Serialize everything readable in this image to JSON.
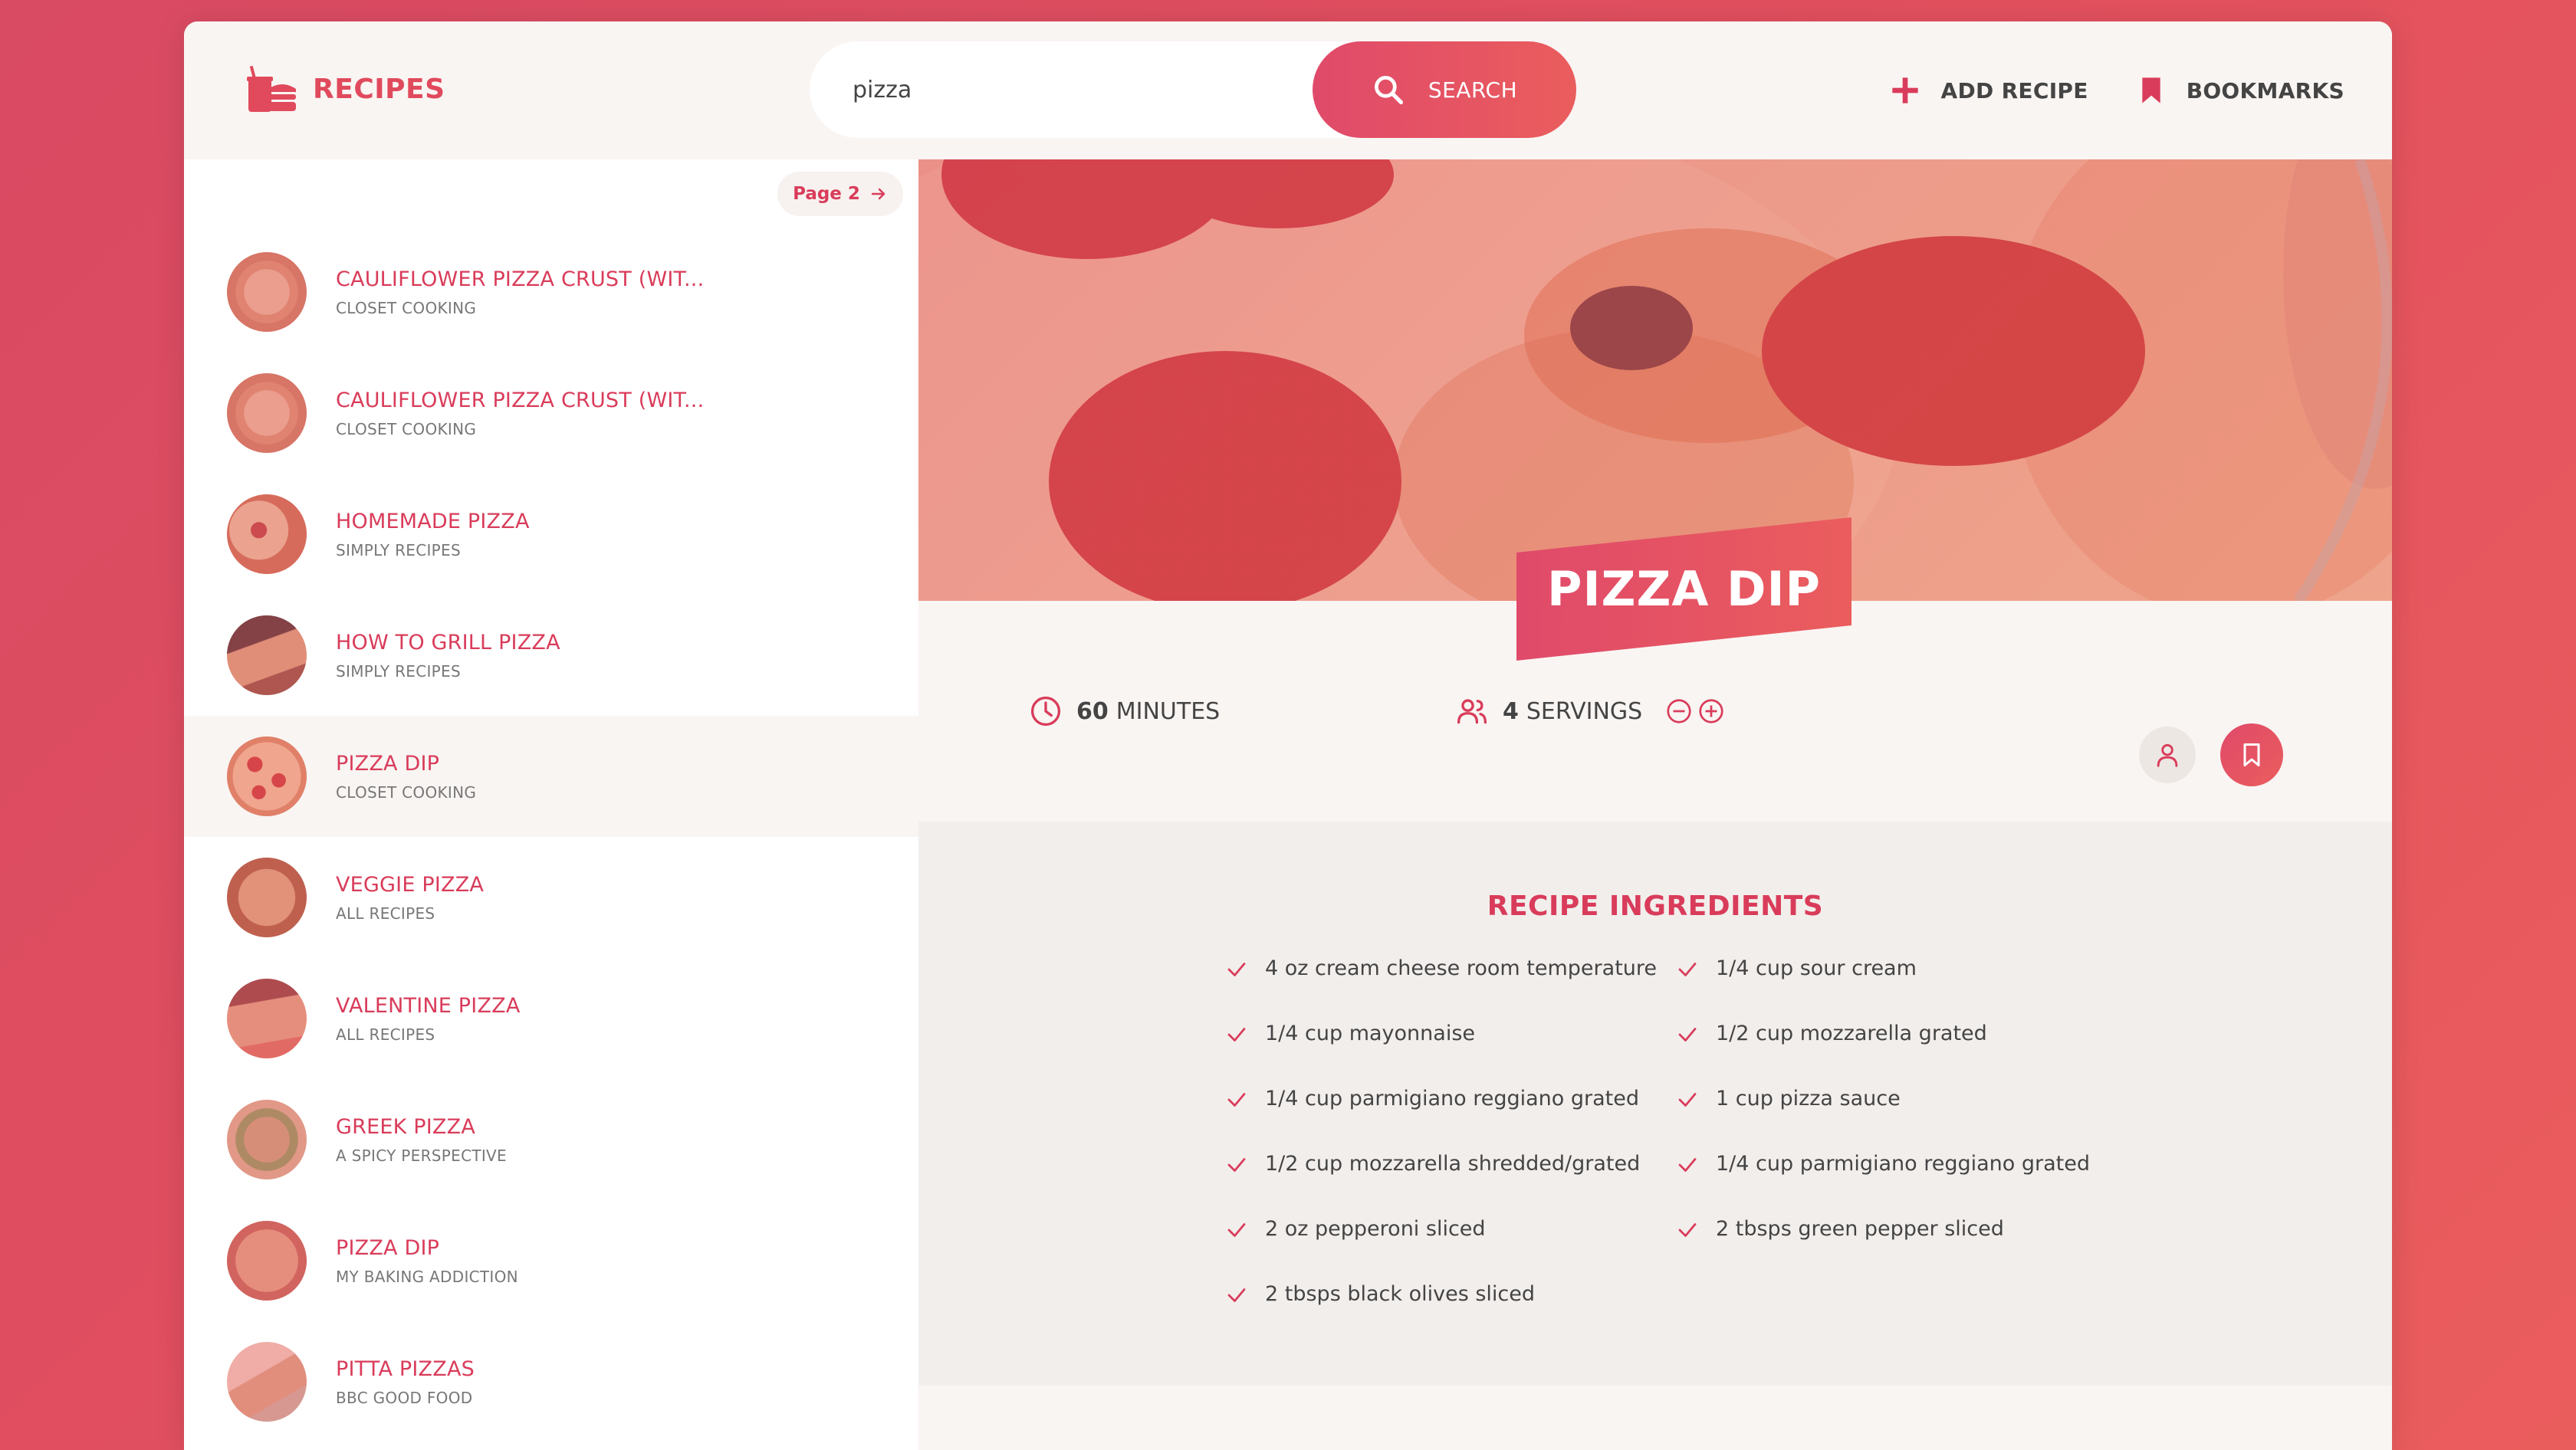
{
  "header": {
    "logo_text": "RECIPES",
    "search_value": "pizza",
    "search_label": "SEARCH",
    "add_recipe_label": "ADD RECIPE",
    "bookmarks_label": "BOOKMARKS"
  },
  "pagination": {
    "next_label": "Page 2"
  },
  "results": [
    {
      "title": "CAULIFLOWER PIZZA CRUST (WIT...",
      "publisher": "CLOSET COOKING"
    },
    {
      "title": "CAULIFLOWER PIZZA CRUST (WIT...",
      "publisher": "CLOSET COOKING"
    },
    {
      "title": "HOMEMADE PIZZA",
      "publisher": "SIMPLY RECIPES"
    },
    {
      "title": "HOW TO GRILL PIZZA",
      "publisher": "SIMPLY RECIPES"
    },
    {
      "title": "PIZZA DIP",
      "publisher": "CLOSET COOKING"
    },
    {
      "title": "VEGGIE PIZZA",
      "publisher": "ALL RECIPES"
    },
    {
      "title": "VALENTINE PIZZA",
      "publisher": "ALL RECIPES"
    },
    {
      "title": "GREEK PIZZA",
      "publisher": "A SPICY PERSPECTIVE"
    },
    {
      "title": "PIZZA DIP",
      "publisher": "MY BAKING ADDICTION"
    },
    {
      "title": "PITTA PIZZAS",
      "publisher": "BBC GOOD FOOD"
    }
  ],
  "recipe": {
    "title": "PIZZA DIP",
    "cooking_time": "60",
    "time_unit": "MINUTES",
    "servings": "4",
    "servings_unit": "SERVINGS",
    "ingredients_heading": "RECIPE INGREDIENTS",
    "ingredients_col1": [
      "4 oz cream cheese room temperature",
      "1/4 cup mayonnaise",
      "1/4 cup parmigiano reggiano grated",
      "1/2 cup mozzarella shredded/grated",
      "2 oz pepperoni sliced",
      "2 tbsps black olives sliced"
    ],
    "ingredients_col2": [
      "1/4 cup sour cream",
      "1/2 cup mozzarella grated",
      "1 cup pizza sauce",
      "1/4 cup parmigiano reggiano grated",
      "2 tbsps green pepper sliced"
    ]
  },
  "colors": {
    "accent": "#d93c5a",
    "accent_gradient_start": "#e04a6a",
    "accent_gradient_end": "#ea5d5d",
    "background": "#f9f5f3"
  },
  "icons": [
    "logo-icon",
    "search-icon",
    "plus-icon",
    "bookmark-icon",
    "arrow-right-icon",
    "clock-icon",
    "users-icon",
    "minus-circle-icon",
    "plus-circle-icon",
    "user-icon",
    "check-icon"
  ]
}
